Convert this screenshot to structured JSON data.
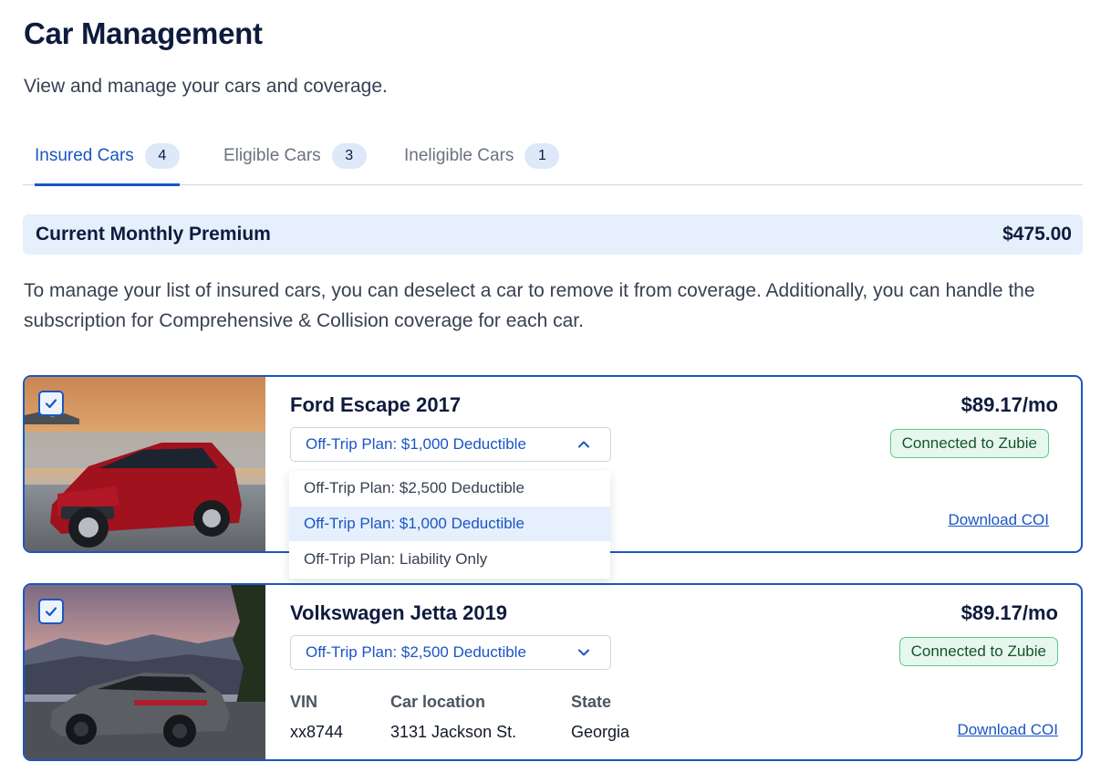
{
  "header": {
    "title": "Car Management",
    "subtitle": "View and manage your cars and coverage."
  },
  "tabs": [
    {
      "label": "Insured Cars",
      "count": "4",
      "active": true
    },
    {
      "label": "Eligible Cars",
      "count": "3",
      "active": false
    },
    {
      "label": "Ineligible Cars",
      "count": "1",
      "active": false
    }
  ],
  "premium": {
    "label": "Current Monthly Premium",
    "amount": "$475.00"
  },
  "description": "To manage your list of insured cars, you can deselect a car to remove it from coverage. Additionally, you can handle the subscription for Comprehensive & Collision coverage for each car.",
  "cars": [
    {
      "name": "Ford Escape 2017",
      "price": "$89.17/mo",
      "plan": "Off-Trip Plan: $1,000 Deductible",
      "badge": "Connected to Zubie",
      "download": "Download COI",
      "checked": true,
      "dropdown_open": true
    },
    {
      "name": "Volkswagen Jetta 2019",
      "price": "$89.17/mo",
      "plan": "Off-Trip Plan: $2,500 Deductible",
      "badge": "Connected to Zubie",
      "download": "Download COI",
      "checked": true,
      "dropdown_open": false,
      "details": [
        {
          "label": "VIN",
          "value": "xx8744"
        },
        {
          "label": "Car location",
          "value": "3131 Jackson St."
        },
        {
          "label": "State",
          "value": "Georgia"
        }
      ]
    }
  ],
  "dropdown": {
    "options": [
      "Off-Trip Plan: $2,500 Deductible",
      "Off-Trip Plan: $1,000 Deductible",
      "Off-Trip Plan: Liability Only"
    ],
    "selected": "Off-Trip Plan: $1,000 Deductible"
  },
  "colors": {
    "accent": "#1a56c4",
    "title": "#0f1b3d",
    "premium_bg": "#e6effc",
    "badge_green_bg": "#e6f8ee",
    "badge_green_border": "#5cc98a"
  },
  "icons": {
    "checkbox": "checkmark-icon",
    "dropdown_open": "chevron-up-icon",
    "dropdown_closed": "chevron-down-icon"
  }
}
